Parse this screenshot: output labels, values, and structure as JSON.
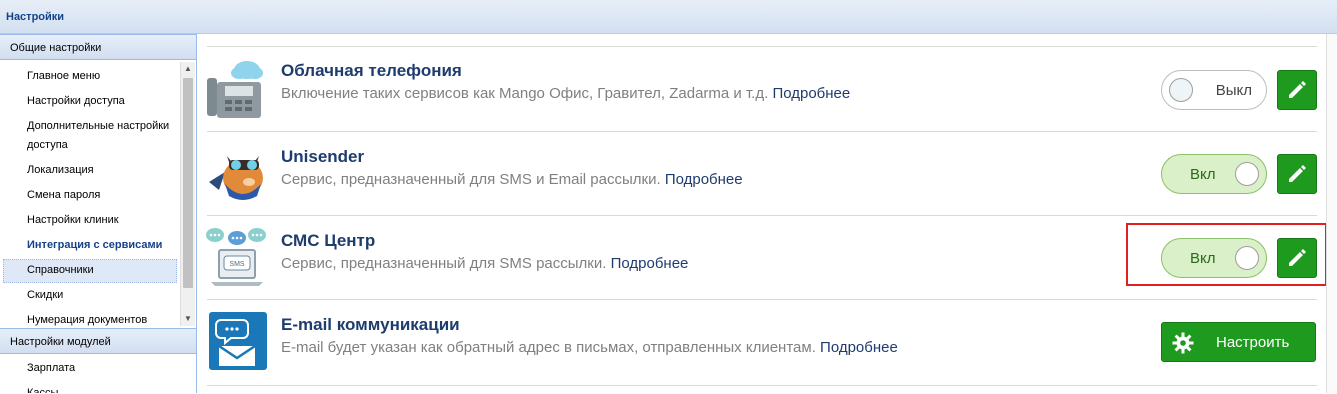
{
  "window": {
    "title": "Настройки"
  },
  "sidebar": {
    "general_section": {
      "title": "Общие настройки"
    },
    "items": [
      {
        "label": "Главное меню"
      },
      {
        "label": "Настройки доступа"
      },
      {
        "label": "Дополнительные настройки доступа"
      },
      {
        "label": "Локализация"
      },
      {
        "label": "Смена пароля"
      },
      {
        "label": "Настройки клиник"
      },
      {
        "label": "Интеграция с сервисами",
        "active": true
      },
      {
        "label": "Справочники"
      },
      {
        "label": "Скидки"
      },
      {
        "label": "Нумерация документов"
      }
    ],
    "modules_section": {
      "title": "Настройки модулей"
    },
    "module_items": [
      {
        "label": "Зарплата"
      },
      {
        "label": "Кассы"
      }
    ]
  },
  "services": [
    {
      "name": "Облачная телефония",
      "desc": "Включение таких сервисов как Mango Офис, Гравител, Zadarma и т.д.",
      "link": "Подробнее",
      "control": "toggle",
      "state": "Выкл",
      "icon": "cloud-phone-icon"
    },
    {
      "name": "Unisender",
      "desc": "Сервис, предназначенный для SMS и Email рассылки.",
      "link": "Подробнее",
      "control": "toggle",
      "state": "Вкл",
      "icon": "unisender-mascot-icon"
    },
    {
      "name": "СМС Центр",
      "desc": "Сервис, предназначенный для SMS рассылки.",
      "link": "Подробнее",
      "control": "toggle",
      "state": "Вкл",
      "icon": "sms-laptop-icon"
    },
    {
      "name": "E-mail коммуникации",
      "desc": "E-mail будет указан как обратный адрес в письмах, отправленных клиентам.",
      "link": "Подробнее",
      "control": "button",
      "button_label": "Настроить",
      "icon": "email-chat-icon"
    }
  ],
  "colors": {
    "accent_green": "#1e9a1e",
    "title_blue": "#1e3c6e",
    "highlight_red": "#e02020"
  }
}
